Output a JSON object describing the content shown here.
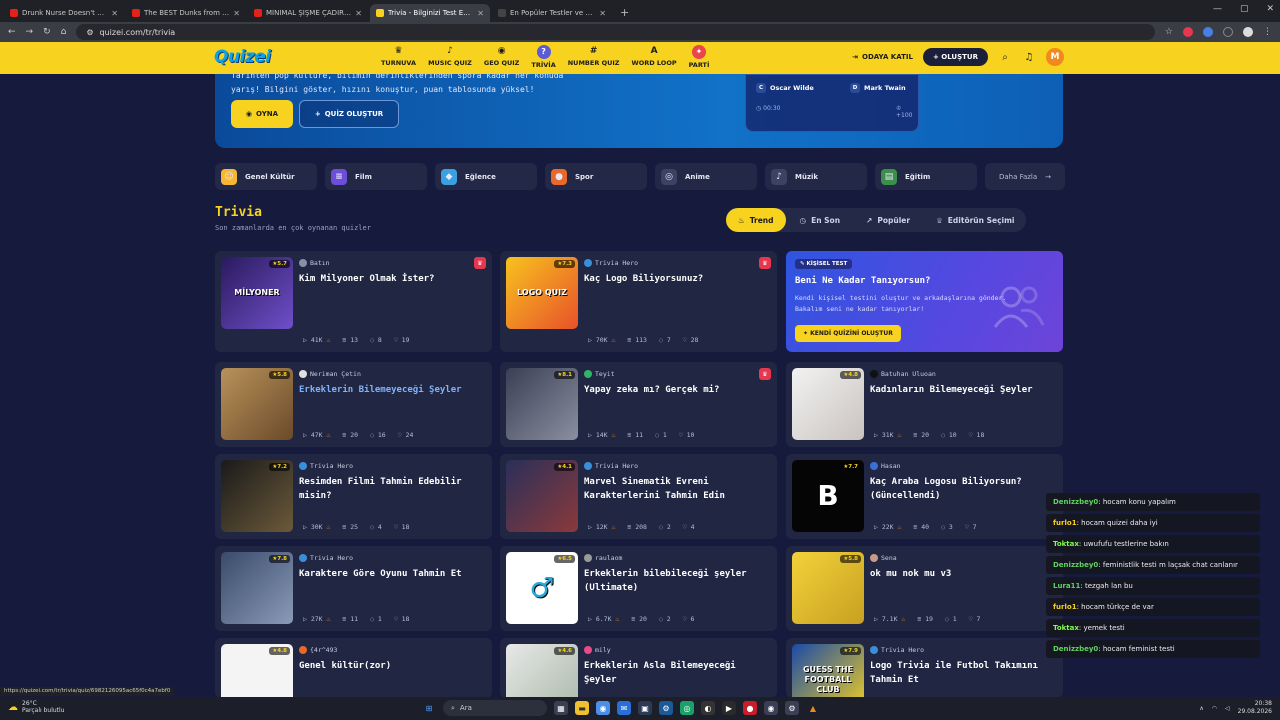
{
  "browser": {
    "tabs": [
      {
        "label": "Drunk Nurse Doesn't Realize S...",
        "color": "#e62117"
      },
      {
        "label": "The BEST Dunks from Shaq's D...",
        "color": "#e62117"
      },
      {
        "label": "MİNİMAL ŞİŞME ÇADIRLA ISSI...",
        "color": "#e62117"
      },
      {
        "label": "Trivia - Bilginizi Test Edin - Quiz...",
        "color": "#f7d21f",
        "active": true
      },
      {
        "label": "En Popüler Testler ve Eğlenceli...",
        "color": "#444"
      }
    ],
    "url": "quizei.com/tr/trivia",
    "status_url": "https://quizei.com/tr/trivia/quiz/6982126095ac65f0c4a7ebf0"
  },
  "header": {
    "logo": "Quizei",
    "nav": [
      {
        "label": "TURNUVA",
        "icon": "trophy-icon",
        "glyph": "♛"
      },
      {
        "label": "MUSIC QUIZ",
        "icon": "music-icon",
        "glyph": "♪"
      },
      {
        "label": "GEO QUIZ",
        "icon": "pin-icon",
        "glyph": "◉"
      },
      {
        "label": "TRİVİA",
        "icon": "trivia-icon",
        "glyph": "?"
      },
      {
        "label": "NUMBER QUIZ",
        "icon": "hash-icon",
        "glyph": "#"
      },
      {
        "label": "WORD LOOP",
        "icon": "word-icon",
        "glyph": "A"
      },
      {
        "label": "PARTİ",
        "icon": "party-icon",
        "glyph": "✦"
      }
    ],
    "join_room": "ODAYA KATIL",
    "create": "OLUŞTUR",
    "avatar_letter": "M"
  },
  "hero": {
    "text_line": "yarış! Bilgini göster, hızını konuştur, puan tablosunda yüksel!",
    "text_top": "Tarihten pop kültüre, bilimin derinliklerinden spora kadar her konuda",
    "play": "OYNA",
    "create_quiz": "QUİZ OLUŞTUR",
    "card": {
      "opt_c_letter": "C",
      "opt_c": "Oscar Wilde",
      "opt_d_letter": "D",
      "opt_d": "Mark Twain",
      "timer": "00:30",
      "points": "+100"
    }
  },
  "categories": [
    {
      "label": "Genel Kültür",
      "glyph": "☺",
      "color": "#f7b733"
    },
    {
      "label": "Film",
      "glyph": "≡",
      "color": "#6b4fd8"
    },
    {
      "label": "Eğlence",
      "glyph": "◆",
      "color": "#3aa0e0"
    },
    {
      "label": "Spor",
      "glyph": "●",
      "color": "#e8692a"
    },
    {
      "label": "Anime",
      "glyph": "◎",
      "color": "#3c4263"
    },
    {
      "label": "Müzik",
      "glyph": "♪",
      "color": "#3c4263"
    },
    {
      "label": "Eğitim",
      "glyph": "▤",
      "color": "#3c8f4a"
    }
  ],
  "categories_more": "Daha Fazla",
  "section": {
    "title": "Trivia",
    "subtitle": "Son zamanlarda en çok oynanan quizler",
    "filters": [
      "Trend",
      "En Son",
      "Popüler",
      "Editörün Seçimi"
    ]
  },
  "promo": {
    "tag": "KİŞİSEL TEST",
    "title": "Beni Ne Kadar Tanıyorsun?",
    "desc": "Kendi kişisel testini oluştur ve arkadaşlarına gönder. Bakalım seni ne kadar tanıyorlar!",
    "button": "KENDİ QUİZİNİ OLUŞTUR"
  },
  "cards": [
    {
      "author": "Batın",
      "title": "Kim Milyoner Olmak İster?",
      "rating": "5.7",
      "views": "41K",
      "q": "13",
      "c": "8",
      "l": "19",
      "badge": true,
      "thumb": "linear-gradient(135deg,#2a1a5e,#6f4fc9)",
      "thumbtext": "MİLYONER",
      "dot": "#8a8fa8"
    },
    {
      "author": "Trivia Hero",
      "title": "Kaç Logo Biliyorsunuz?",
      "rating": "7.3",
      "views": "70K",
      "q": "113",
      "c": "7",
      "l": "28",
      "badge": true,
      "thumb": "linear-gradient(135deg,#f7c21f,#e8512a)",
      "thumbtext": "LOGO QUIZ",
      "dot": "#3a8fd8"
    },
    {
      "author": "Neriman Çetin",
      "title": "Erkeklerin Bilemeyeceği Şeyler",
      "rating": "5.8",
      "views": "47K",
      "q": "20",
      "c": "16",
      "l": "24",
      "badge": false,
      "link": true,
      "thumb": "linear-gradient(135deg,#b8925a,#6b4a2a)",
      "thumbtext": "",
      "dot": "#e0e0e0"
    },
    {
      "author": "Teyit",
      "title": "Yapay zeka mı? Gerçek mi?",
      "rating": "8.1",
      "views": "14K",
      "q": "11",
      "c": "1",
      "l": "10",
      "badge": true,
      "thumb": "linear-gradient(135deg,#3a3f55,#8a8fa0)",
      "thumbtext": "",
      "dot": "#2fb56a"
    },
    {
      "author": "Batuhan Uluoan",
      "title": "Kadınların Bilemeyeceği Şeyler",
      "rating": "4.8",
      "views": "31K",
      "q": "20",
      "c": "10",
      "l": "18",
      "badge": false,
      "thumb": "linear-gradient(135deg,#f2f2f2,#c9c3c0)",
      "thumbtext": "",
      "dot": "#111"
    },
    {
      "author": "Trivia Hero",
      "title": "Resimden Filmi Tahmin Edebilir misin?",
      "rating": "7.2",
      "views": "30K",
      "q": "25",
      "c": "4",
      "l": "18",
      "badge": false,
      "thumb": "linear-gradient(135deg,#1a1a1a,#6b5a3a)",
      "thumbtext": "",
      "dot": "#3a8fd8"
    },
    {
      "author": "Trivia Hero",
      "title": "Marvel Sinematik Evreni Karakterlerini Tahmin Edin",
      "rating": "4.1",
      "views": "12K",
      "q": "208",
      "c": "2",
      "l": "4",
      "badge": false,
      "thumb": "linear-gradient(135deg,#2a2f5a,#8a3a3a)",
      "thumbtext": "",
      "dot": "#3a8fd8"
    },
    {
      "author": "Hasan",
      "title": "Kaç Araba Logosu Biliyorsun? (Güncellendi)",
      "rating": "7.7",
      "views": "22K",
      "q": "40",
      "c": "3",
      "l": "7",
      "badge": false,
      "thumb": "#050505",
      "thumbtext": "B",
      "dot": "#3a6fd8"
    },
    {
      "author": "Trivia Hero",
      "title": "Karaktere Göre Oyunu Tahmin Et",
      "rating": "7.8",
      "views": "27K",
      "q": "11",
      "c": "1",
      "l": "18",
      "badge": false,
      "thumb": "linear-gradient(135deg,#3a4a6a,#8a9ab8)",
      "thumbtext": "",
      "dot": "#3a8fd8"
    },
    {
      "author": "raulaom",
      "title": "Erkeklerin bilebileceği şeyler (Ultimate)",
      "rating": "6.5",
      "views": "6.7K",
      "q": "20",
      "c": "2",
      "l": "6",
      "badge": false,
      "thumb": "#ffffff",
      "thumbtext": "♂",
      "dot": "#9a9a9a"
    },
    {
      "author": "Sena",
      "title": "ok mu nok mu v3",
      "rating": "5.8",
      "views": "7.1K",
      "q": "19",
      "c": "1",
      "l": "7",
      "badge": false,
      "thumb": "linear-gradient(135deg,#f2d23a,#c8a020)",
      "thumbtext": "",
      "dot": "#c89a8a"
    },
    {
      "author": "{4r^493",
      "title": "Genel kültür(zor)",
      "rating": "4.8",
      "views": "",
      "q": "",
      "c": "",
      "l": "",
      "badge": false,
      "thumb": "#f4f4f4",
      "thumbtext": "",
      "dot": "#e8692a"
    },
    {
      "author": "mily",
      "title": "Erkeklerin Asla Bilemeyeceği Şeyler",
      "rating": "4.6",
      "views": "",
      "q": "",
      "c": "",
      "l": "",
      "badge": false,
      "thumb": "linear-gradient(135deg,#e8e8e8,#a8b8a8)",
      "thumbtext": "",
      "dot": "#e84a8a"
    },
    {
      "author": "Trivia Hero",
      "title": "Logo Trivia ile Futbol Takımını Tahmin Et",
      "rating": "7.9",
      "views": "",
      "q": "",
      "c": "",
      "l": "",
      "badge": false,
      "thumb": "linear-gradient(135deg,#1a4aa8,#f7d21f)",
      "thumbtext": "GUESS THE FOOTBALL CLUB",
      "dot": "#3a8fd8"
    }
  ],
  "chat": [
    {
      "user": "Denizzbey0",
      "color": "#5fd35f",
      "msg": "hocam konu yapalım"
    },
    {
      "user": "furlo1",
      "color": "#f7d21f",
      "msg": "hocam quizei daha iyi"
    },
    {
      "user": "Toktax",
      "color": "#7dff4a",
      "msg": "uwufufu testlerine bakın"
    },
    {
      "user": "Denizzbey0",
      "color": "#5fd35f",
      "msg": "feministlik testi m laçsak chat canlanır"
    },
    {
      "user": "Lura11",
      "color": "#5fd35f",
      "msg": "tezgah lan bu"
    },
    {
      "user": "furlo1",
      "color": "#f7d21f",
      "msg": "hocam türkçe de var"
    },
    {
      "user": "Toktax",
      "color": "#7dff4a",
      "msg": "yemek testi"
    },
    {
      "user": "Denizzbey0",
      "color": "#5fd35f",
      "msg": "hocam feminist testi"
    }
  ],
  "taskbar": {
    "temp": "26°C",
    "weather": "Parçalı bulutlu",
    "search": "Ara",
    "time": "20:38",
    "date": "29.08.2026"
  }
}
